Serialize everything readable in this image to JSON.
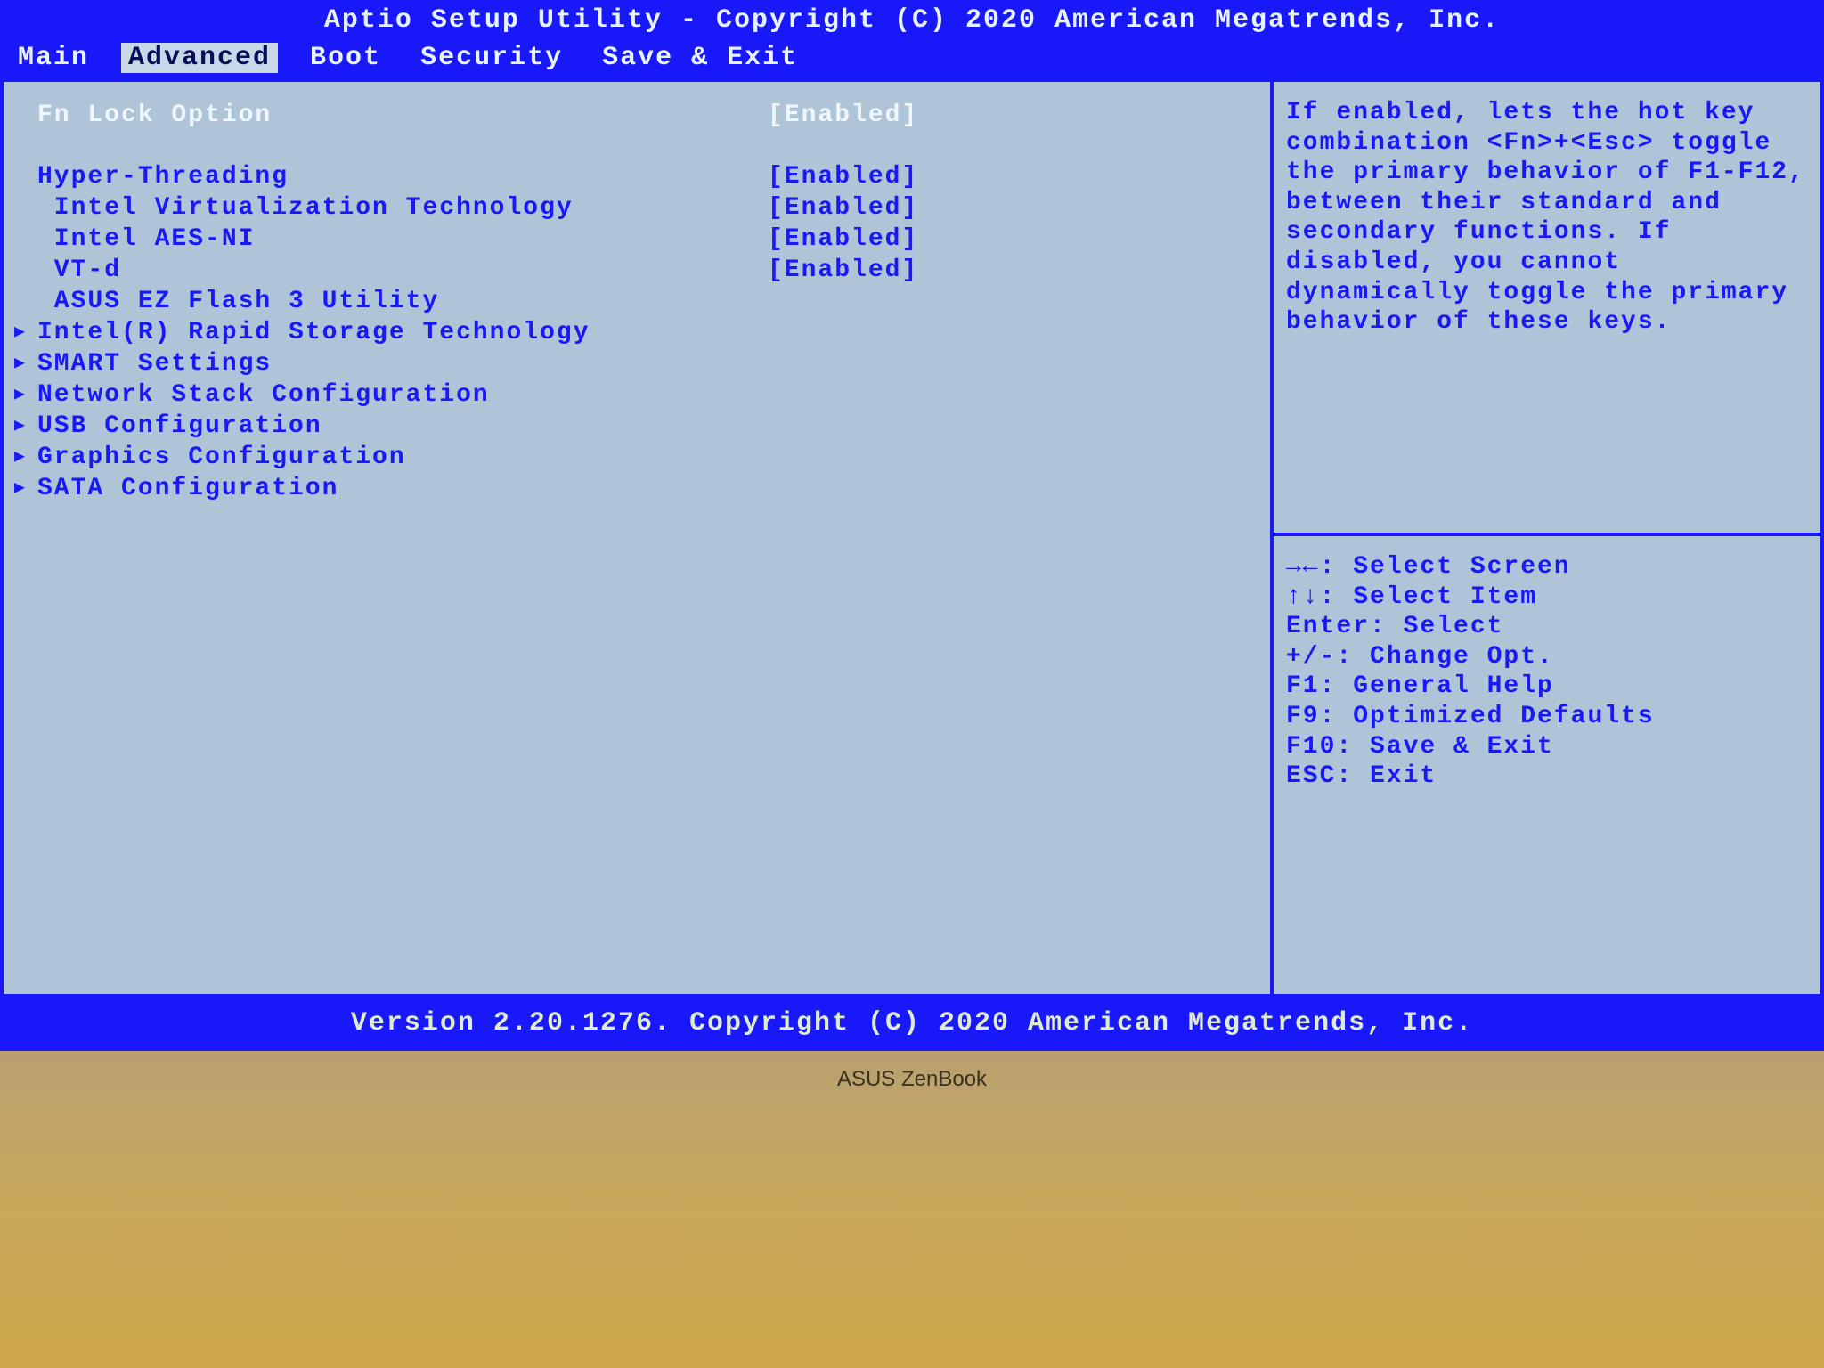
{
  "title": "Aptio Setup Utility - Copyright (C) 2020 American Megatrends, Inc.",
  "footer": "Version 2.20.1276. Copyright (C) 2020 American Megatrends, Inc.",
  "menu": {
    "items": [
      "Main",
      "Advanced",
      "Boot",
      "Security",
      "Save & Exit"
    ],
    "active_index": 1
  },
  "rows": [
    {
      "type": "plain",
      "selected": true,
      "label": "Fn Lock Option",
      "value": "[Enabled]"
    },
    {
      "type": "spacer"
    },
    {
      "type": "plain",
      "selected": false,
      "label": "Hyper-Threading",
      "value": "[Enabled]"
    },
    {
      "type": "plain",
      "selected": false,
      "label": " Intel Virtualization Technology",
      "value": "[Enabled]"
    },
    {
      "type": "plain",
      "selected": false,
      "label": " Intel AES-NI",
      "value": "[Enabled]"
    },
    {
      "type": "plain",
      "selected": false,
      "label": " VT-d",
      "value": "[Enabled]"
    },
    {
      "type": "plain",
      "selected": false,
      "label": " ASUS EZ Flash 3 Utility",
      "value": ""
    },
    {
      "type": "submenu",
      "selected": false,
      "label": "Intel(R) Rapid Storage Technology",
      "value": ""
    },
    {
      "type": "submenu",
      "selected": false,
      "label": "SMART Settings",
      "value": ""
    },
    {
      "type": "submenu",
      "selected": false,
      "label": "Network Stack Configuration",
      "value": ""
    },
    {
      "type": "submenu",
      "selected": false,
      "label": "USB Configuration",
      "value": ""
    },
    {
      "type": "submenu",
      "selected": false,
      "label": "Graphics Configuration",
      "value": ""
    },
    {
      "type": "submenu",
      "selected": false,
      "label": "SATA Configuration",
      "value": ""
    }
  ],
  "help_text": "If enabled, lets the hot key combination <Fn>+<Esc> toggle the primary behavior of F1-F12, between their standard and secondary functions. If disabled, you cannot dynamically toggle the primary behavior of these keys.",
  "key_help": [
    "→←: Select Screen",
    "↑↓: Select Item",
    "Enter: Select",
    "+/-: Change Opt.",
    "F1: General Help",
    "F9: Optimized Defaults",
    "F10: Save & Exit",
    "ESC: Exit"
  ],
  "laptop_brand": "ASUS ZenBook"
}
